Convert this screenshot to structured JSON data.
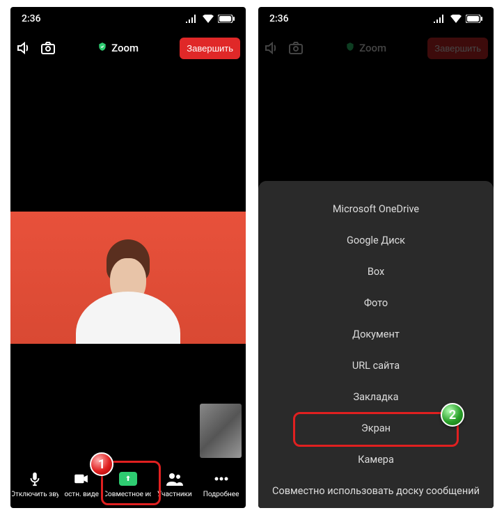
{
  "status": {
    "time": "2:36"
  },
  "topbar": {
    "title": "Zoom",
    "end": "Завершить"
  },
  "bottombar": {
    "mute": "Отключить зву",
    "video": "остн. виде",
    "share": "Совместное ис",
    "participants": "Участники",
    "more": "Подробнее"
  },
  "share_options": [
    "Microsoft OneDrive",
    "Google Диск",
    "Box",
    "Фото",
    "Документ",
    "URL сайта",
    "Закладка",
    "Экран",
    "Камера",
    "Совместно использовать доску сообщений"
  ],
  "badges": {
    "one": "1",
    "two": "2"
  }
}
